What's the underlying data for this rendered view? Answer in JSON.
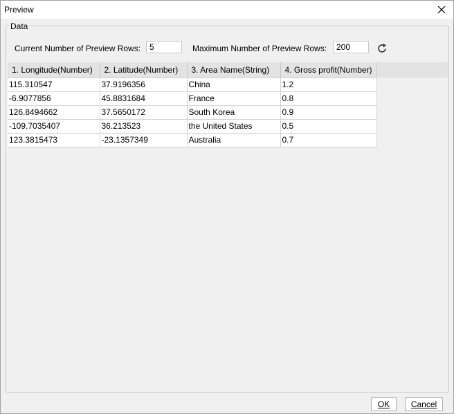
{
  "window": {
    "title": "Preview"
  },
  "icons": {
    "close": "close-icon",
    "refresh": "refresh-icon"
  },
  "data_group": {
    "legend": "Data",
    "current_rows_label": "Current Number of Preview Rows:",
    "current_rows_value": "5",
    "max_rows_label": "Maximum Number of Preview Rows:",
    "max_rows_value": "200"
  },
  "table": {
    "columns": [
      "1. Longitude(Number)",
      "2. Latitude(Number)",
      "3. Area Name(String)",
      "4. Gross profit(Number)"
    ],
    "rows": [
      [
        "115.310547",
        "37.9196356",
        "China",
        "1.2"
      ],
      [
        "-6.9077856",
        "45.8831684",
        "France",
        "0.8"
      ],
      [
        "126.8494662",
        "37.5650172",
        "South Korea",
        "0.9"
      ],
      [
        "-109.7035407",
        "36.213523",
        "the United States",
        "0.5"
      ],
      [
        "123.3815473",
        "-23.1357349",
        "Australia",
        "0.7"
      ]
    ]
  },
  "footer": {
    "ok_label": "OK",
    "cancel_label": "Cancel"
  },
  "colors": {
    "window_bg": "#f0f0f0",
    "header_bg": "#e3e3e3",
    "border": "#c8c8c8"
  }
}
